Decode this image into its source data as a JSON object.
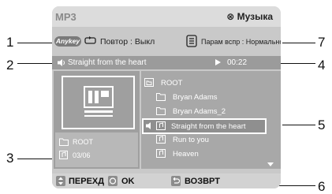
{
  "callouts": [
    "1",
    "2",
    "3",
    "4",
    "5",
    "6",
    "7"
  ],
  "header": {
    "mode": "MP3",
    "section": "⊗ Музыка"
  },
  "status": {
    "anykey_label": "Anykey",
    "repeat": "Повтор : Выкл",
    "params": "Парам вспр : Нормальное"
  },
  "now_playing": {
    "title": "Straight from the heart",
    "time": "00:22"
  },
  "info": {
    "folder": "ROOT",
    "track_count": "03/06"
  },
  "file_list": [
    {
      "icon": "parent-folder-icon",
      "label": "ROOT"
    },
    {
      "icon": "folder-icon",
      "label": "Bryan Adams"
    },
    {
      "icon": "folder-icon",
      "label": "Bryan Adams_2"
    },
    {
      "icon": "music-note-icon",
      "label": "Straight from the heart",
      "selected": true
    },
    {
      "icon": "music-note-icon",
      "label": "Run to you"
    },
    {
      "icon": "music-note-icon",
      "label": "Heaven"
    }
  ],
  "bottom": {
    "move": "ПЕРЕХД",
    "ok": "OK",
    "back": "ВОЗВРТ"
  },
  "colors": {
    "frame": "#c9c9c9",
    "panel": "#9f9f9f",
    "now_playing_bar": "#9b9b9b"
  }
}
